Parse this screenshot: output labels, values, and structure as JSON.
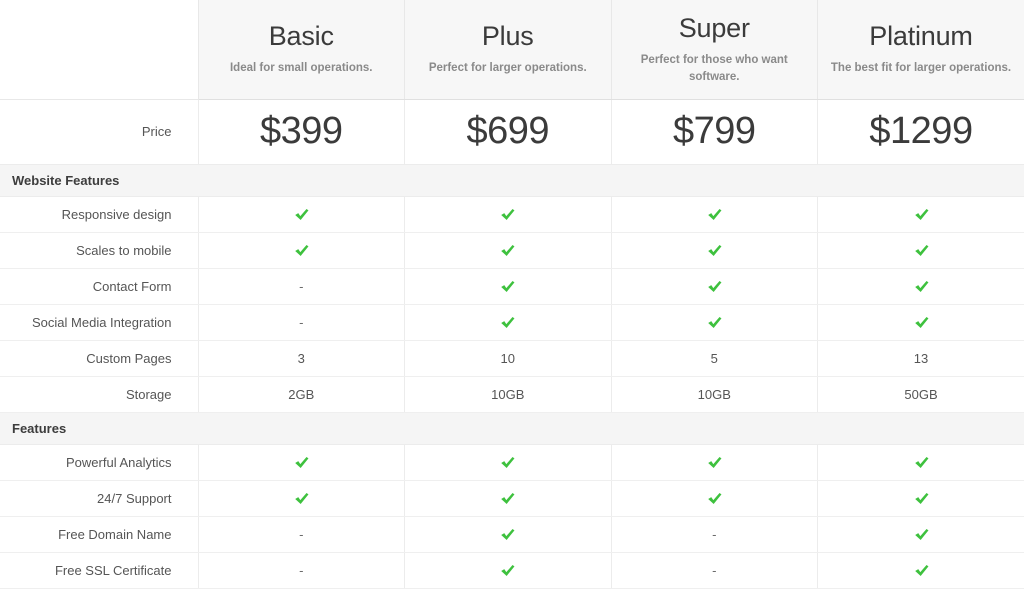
{
  "table": {
    "label_column_header": "",
    "plans": [
      {
        "name": "Basic",
        "desc": "Ideal for small operations.",
        "price": "$399"
      },
      {
        "name": "Plus",
        "desc": "Perfect for larger operations.",
        "price": "$699"
      },
      {
        "name": "Super",
        "desc": "Perfect for those who want software.",
        "price": "$799"
      },
      {
        "name": "Platinum",
        "desc": "The best fit for larger operations.",
        "price": "$1299"
      }
    ],
    "price_row_label": "Price",
    "sections": [
      {
        "title": "Website Features",
        "rows": [
          {
            "label": "Responsive design",
            "values": [
              "check",
              "check",
              "check",
              "check"
            ]
          },
          {
            "label": "Scales to mobile",
            "values": [
              "check",
              "check",
              "check",
              "check"
            ]
          },
          {
            "label": "Contact Form",
            "values": [
              "-",
              "check",
              "check",
              "check"
            ]
          },
          {
            "label": "Social Media Integration",
            "values": [
              "-",
              "check",
              "check",
              "check"
            ]
          },
          {
            "label": "Custom Pages",
            "values": [
              "3",
              "10",
              "5",
              "13"
            ]
          },
          {
            "label": "Storage",
            "values": [
              "2GB",
              "10GB",
              "10GB",
              "50GB"
            ]
          }
        ]
      },
      {
        "title": "Features",
        "rows": [
          {
            "label": "Powerful Analytics",
            "values": [
              "check",
              "check",
              "check",
              "check"
            ]
          },
          {
            "label": "24/7 Support",
            "values": [
              "check",
              "check",
              "check",
              "check"
            ]
          },
          {
            "label": "Free Domain Name",
            "values": [
              "-",
              "check",
              "-",
              "check"
            ]
          },
          {
            "label": "Free SSL Certificate",
            "values": [
              "-",
              "check",
              "-",
              "check"
            ]
          }
        ]
      }
    ],
    "icons": {
      "check": "check-icon",
      "dash": "not-included-dash"
    },
    "colors": {
      "check_green": "#3ec13e",
      "header_bg": "#f7f7f7",
      "section_bg": "#f5f5f5",
      "border": "#ececec",
      "text": "#555555",
      "heading_text": "#3b3b3b",
      "muted_text": "#8a8a8a"
    }
  }
}
